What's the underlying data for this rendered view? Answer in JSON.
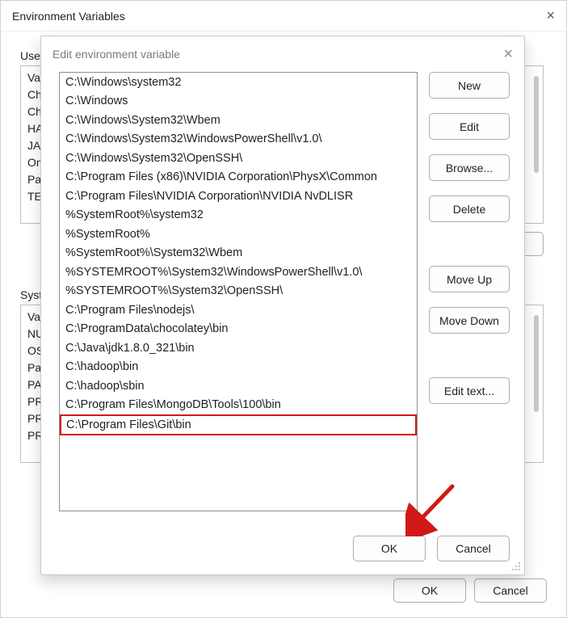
{
  "parent": {
    "title": "Environment Variables",
    "user_label_prefix": "User",
    "user_rows": [
      "Va",
      "Ch",
      "Ch",
      "HA",
      "JA",
      "On",
      "Pa",
      "TE"
    ],
    "sys_label_prefix": "Syste",
    "sys_rows": [
      "Va",
      "NU",
      "OS",
      "Pa",
      "PA",
      "PR",
      "PR",
      "PR"
    ],
    "ok": "OK",
    "cancel": "Cancel"
  },
  "modal": {
    "title": "Edit environment variable",
    "paths": [
      "C:\\Windows\\system32",
      "C:\\Windows",
      "C:\\Windows\\System32\\Wbem",
      "C:\\Windows\\System32\\WindowsPowerShell\\v1.0\\",
      "C:\\Windows\\System32\\OpenSSH\\",
      "C:\\Program Files (x86)\\NVIDIA Corporation\\PhysX\\Common",
      "C:\\Program Files\\NVIDIA Corporation\\NVIDIA NvDLISR",
      "%SystemRoot%\\system32",
      "%SystemRoot%",
      "%SystemRoot%\\System32\\Wbem",
      "%SYSTEMROOT%\\System32\\WindowsPowerShell\\v1.0\\",
      "%SYSTEMROOT%\\System32\\OpenSSH\\",
      "C:\\Program Files\\nodejs\\",
      "C:\\ProgramData\\chocolatey\\bin",
      "C:\\Java\\jdk1.8.0_321\\bin",
      "C:\\hadoop\\bin",
      "C:\\hadoop\\sbin",
      "C:\\Program Files\\MongoDB\\Tools\\100\\bin",
      "C:\\Program Files\\Git\\bin"
    ],
    "highlight_index": 18,
    "buttons": {
      "new_": "New",
      "edit": "Edit",
      "browse": "Browse...",
      "delete_": "Delete",
      "move_up": "Move Up",
      "move_down": "Move Down",
      "edit_text": "Edit text..."
    },
    "ok": "OK",
    "cancel": "Cancel"
  }
}
